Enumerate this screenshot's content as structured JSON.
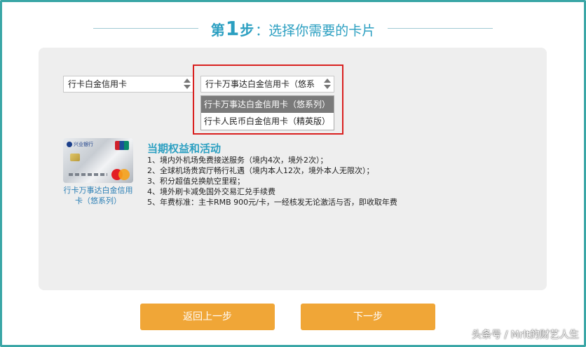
{
  "header": {
    "prefix": "第",
    "step_number": "1",
    "suffix": "步",
    "title": "：选择你需要的卡片"
  },
  "selects": {
    "level": {
      "value": "行卡白金信用卡"
    },
    "card": {
      "value": "行卡万事达白金信用卡（悠系",
      "options": [
        "行卡万事达白金信用卡（悠系列）",
        "行卡人民币白金信用卡（精英版）"
      ],
      "selected_index": 0
    }
  },
  "card": {
    "bank_name": "兴业银行",
    "name": "行卡万事达白金信用卡（悠系列）"
  },
  "benefits": {
    "title": "当期权益和活动",
    "items": [
      "1、境内外机场免费接送服务（境内4次，境外2次）；",
      "2、全球机场贵宾厅畅行礼遇（境内本人12次，境外本人无限次）；",
      "3、积分超值兑换航空里程；",
      "4、境外刷卡减免国外交易汇兑手续费",
      "5、年费标准：主卡RMB 900元/卡，一经核发无论激活与否，即收取年费"
    ]
  },
  "buttons": {
    "back": "返回上一步",
    "next": "下一步"
  },
  "watermark": "头条号 / Mrlt的财艺人生",
  "colors": {
    "accent": "#2b9fc1",
    "button": "#f0a637",
    "highlight": "#d9201f",
    "frame": "#3aa6a6"
  }
}
